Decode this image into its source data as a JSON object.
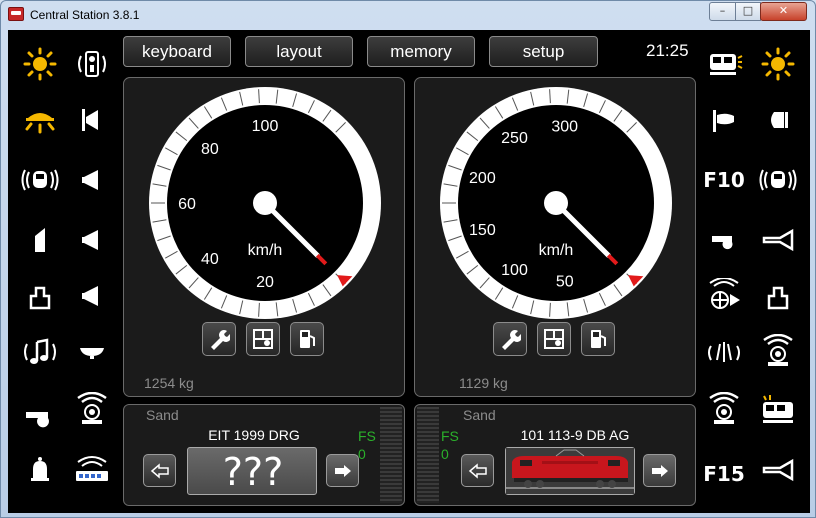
{
  "window": {
    "title": "Central Station 3.8.1",
    "minimize": "–",
    "maximize": "□",
    "close": "✕"
  },
  "topbar": {
    "keyboard": "keyboard",
    "layout": "layout",
    "memory": "memory",
    "setup": "setup",
    "clock": "21:25"
  },
  "left_loco": {
    "speedometer": {
      "ticks": [
        "20",
        "40",
        "60",
        "80",
        "100"
      ],
      "unit": "km/h",
      "max": 120,
      "speed": 0
    },
    "weight": "1254 kg",
    "sand": "Sand",
    "name": "EIT 1999 DRG",
    "fs_label": "FS",
    "fs_value": "0",
    "picture_placeholder": "???"
  },
  "right_loco": {
    "speedometer": {
      "ticks": [
        "50",
        "100",
        "150",
        "200",
        "250",
        "300"
      ],
      "unit": "km/h",
      "max": 350,
      "speed": 0
    },
    "weight": "1129 kg",
    "sand": "Sand",
    "name": "101 113-9 DB AG",
    "fs_label": "FS",
    "fs_value": "0"
  },
  "function_keys": {
    "right_f10": "F10",
    "right_f15": "F15"
  },
  "colors": {
    "accent_yellow": "#f5b800",
    "fs_green": "#2bb02b",
    "needle_red": "#e21a1a",
    "loco_red": "#c8161d"
  },
  "icons": [
    "light-icon",
    "signal-sound-icon",
    "cab-light-icon",
    "horn-icon",
    "loco-sound-icon",
    "whistle-icon",
    "coupler-icon",
    "music-icon",
    "fan-icon",
    "shunting-icon",
    "wrench-icon",
    "display-icon",
    "fuel-icon",
    "arrow-left-icon",
    "arrow-right-icon"
  ]
}
